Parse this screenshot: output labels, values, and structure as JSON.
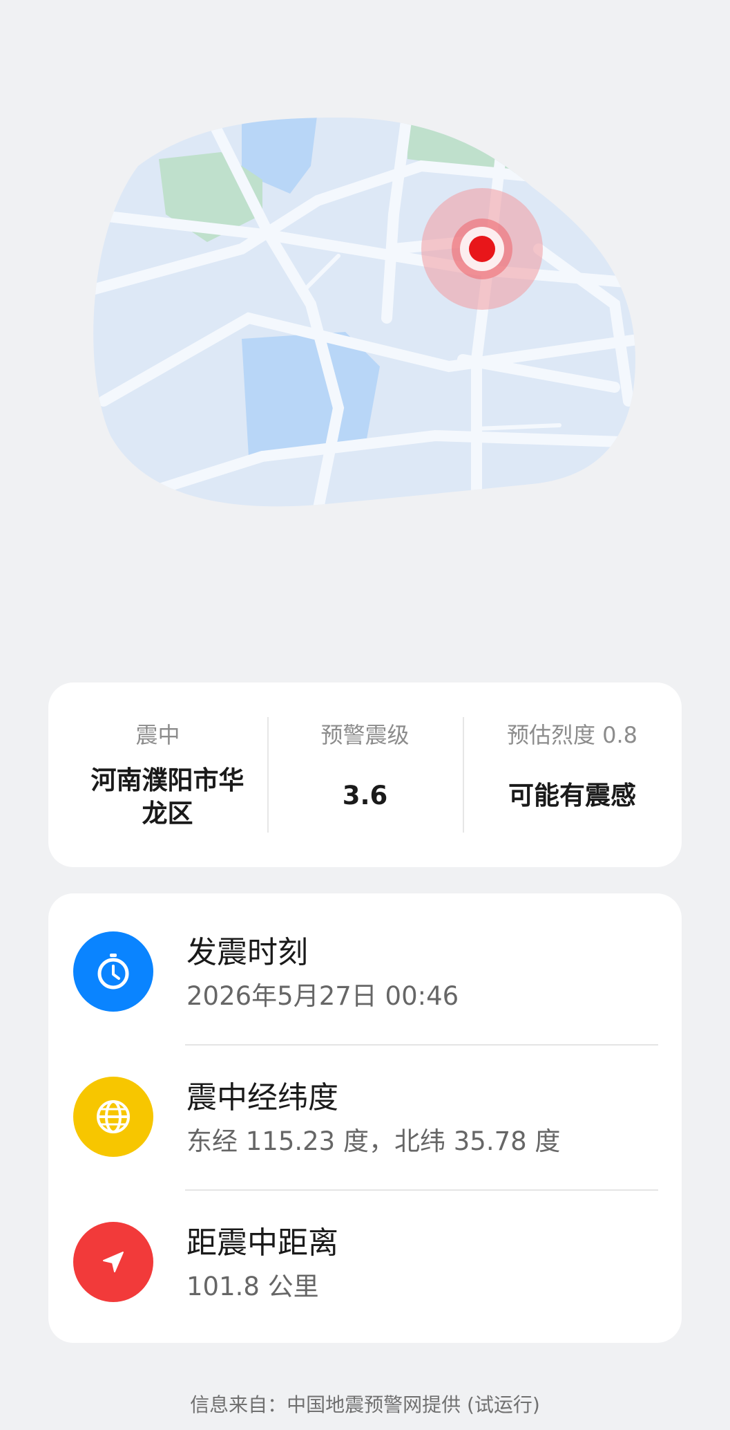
{
  "summary": {
    "epicenter_label": "震中",
    "epicenter_value": "河南濮阳市华龙区",
    "magnitude_label": "预警震级",
    "magnitude_value": "3.6",
    "intensity_label": "预估烈度 0.8",
    "intensity_value": "可能有震感"
  },
  "details": {
    "time": {
      "title": "发震时刻",
      "value": "2026年5月27日 00:46",
      "icon": "clock-icon",
      "color": "#0a84ff"
    },
    "coordinates": {
      "title": "震中经纬度",
      "value": "东经 115.23 度，北纬 35.78 度",
      "icon": "globe-icon",
      "color": "#f7c600"
    },
    "distance": {
      "title": "距震中距离",
      "value": "101.8 公里",
      "icon": "navigation-arrow-icon",
      "color": "#f23a3a"
    }
  },
  "footer": {
    "source": "信息来自：中国地震预警网提供 (试运行)"
  },
  "colors": {
    "background": "#f0f1f3",
    "map_land": "#dde8f6",
    "map_water": "#b8d6f7",
    "map_park": "#bfe0cc",
    "epicenter_red": "#e8161a"
  }
}
